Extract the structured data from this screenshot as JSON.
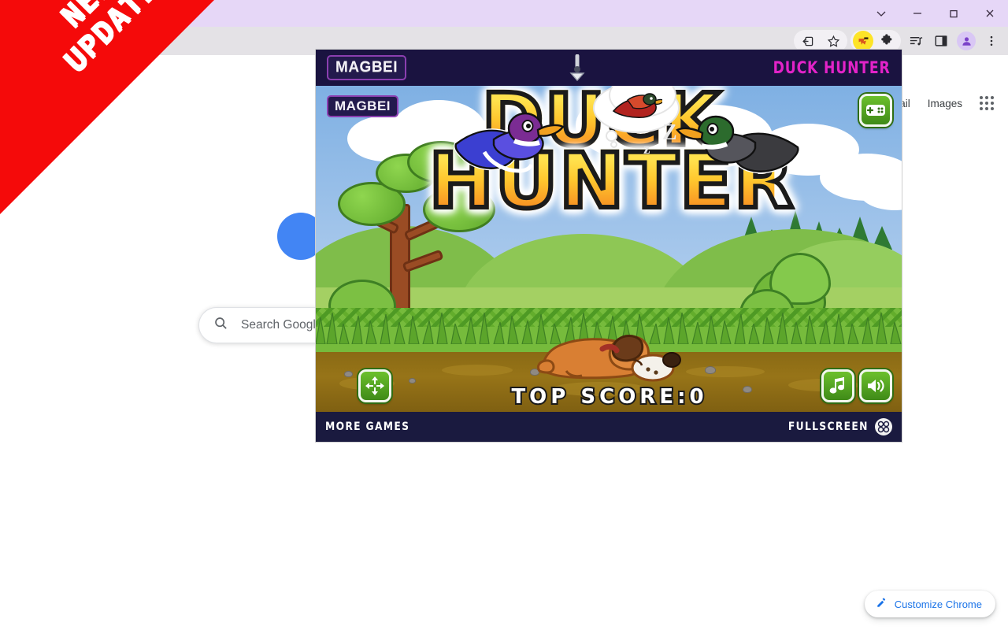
{
  "browser": {
    "window_controls": [
      {
        "name": "chevron-down",
        "label": "⌄"
      },
      {
        "name": "minimize",
        "label": "—"
      },
      {
        "name": "restore",
        "label": "❐"
      },
      {
        "name": "close",
        "label": "✕"
      }
    ],
    "toolbar_icons": [
      {
        "name": "share-icon"
      },
      {
        "name": "bookmark-star-icon"
      },
      {
        "name": "extension-highlight-icon"
      },
      {
        "name": "extensions-puzzle-icon"
      },
      {
        "name": "media-playlist-icon"
      },
      {
        "name": "side-panel-icon"
      },
      {
        "name": "profile-avatar-icon"
      },
      {
        "name": "chrome-menu-icon"
      }
    ]
  },
  "ntp": {
    "links": [
      {
        "label": "ail"
      },
      {
        "label": "Images"
      }
    ],
    "apps_label": "Google apps",
    "search": {
      "placeholder": "Search Google",
      "icon": "search-icon"
    },
    "customize": {
      "label": "Customize Chrome",
      "icon": "pencil-icon"
    }
  },
  "ribbon": {
    "line1": "NEW",
    "line2": "UPDATE",
    "color": "#f50a0a"
  },
  "game": {
    "header": {
      "brand": "MAGBEI",
      "title": "DUCK HUNTER",
      "title_color": "#e323c8",
      "arrow_icon": "down-arrow-icon",
      "bg": "#1a1340"
    },
    "watermark": "MAGBEI",
    "logo": {
      "line1": "DUCK",
      "line2": "HUNTER"
    },
    "score_label": "TOP SCORE:0",
    "buttons": {
      "gamepad": "gamepad-icon",
      "resize": "resize-arrows-icon",
      "music": "music-note-icon",
      "sound": "speaker-icon"
    },
    "footer": {
      "more_games": "MORE GAMES",
      "fullscreen": "FULLSCREEN",
      "fullscreen_icon": "fullscreen-icon",
      "bg": "#1a1a3f"
    }
  }
}
